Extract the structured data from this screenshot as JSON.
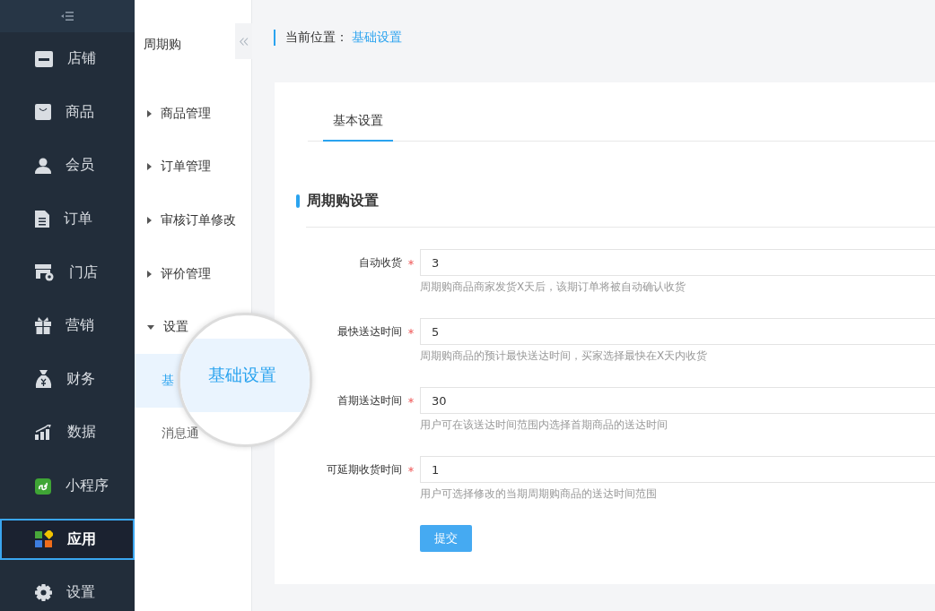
{
  "main_nav": [
    {
      "label": "店铺",
      "selected": false
    },
    {
      "label": "商品",
      "selected": false
    },
    {
      "label": "会员",
      "selected": false
    },
    {
      "label": "订单",
      "selected": false
    },
    {
      "label": "门店",
      "selected": false
    },
    {
      "label": "营销",
      "selected": false
    },
    {
      "label": "财务",
      "selected": false
    },
    {
      "label": "数据",
      "selected": false
    },
    {
      "label": "小程序",
      "selected": false
    },
    {
      "label": "应用",
      "selected": true
    },
    {
      "label": "设置",
      "selected": false
    }
  ],
  "sub_nav": {
    "title": "周期购",
    "groups": [
      {
        "label": "商品管理",
        "expanded": false
      },
      {
        "label": "订单管理",
        "expanded": false
      },
      {
        "label": "审核订单修改",
        "expanded": false
      },
      {
        "label": "评价管理",
        "expanded": false
      },
      {
        "label": "设置",
        "expanded": true,
        "children": [
          {
            "label": "基",
            "selected": true
          },
          {
            "label": "消息通",
            "selected": false
          }
        ]
      }
    ]
  },
  "magnifier": {
    "text": "基础设置"
  },
  "breadcrumb": {
    "label": "当前位置：",
    "current": "基础设置"
  },
  "tabs": [
    {
      "label": "基本设置",
      "selected": true
    }
  ],
  "section": {
    "title": "周期购设置"
  },
  "form": {
    "fields": [
      {
        "label": "自动收货",
        "required": true,
        "value": "3",
        "hint": "周期购商品商家发货X天后，该期订单将被自动确认收货"
      },
      {
        "label": "最快送达时间",
        "required": true,
        "value": "5",
        "hint": "周期购商品的预计最快送达时间，买家选择最快在X天内收货"
      },
      {
        "label": "首期送达时间",
        "required": true,
        "value": "30",
        "hint": "用户可在该送达时间范围内选择首期商品的送达时间"
      },
      {
        "label": "可延期收货时间",
        "required": true,
        "value": "1",
        "hint": "用户可选择修改的当期周期购商品的送达时间范围"
      }
    ],
    "submit": "提交"
  }
}
